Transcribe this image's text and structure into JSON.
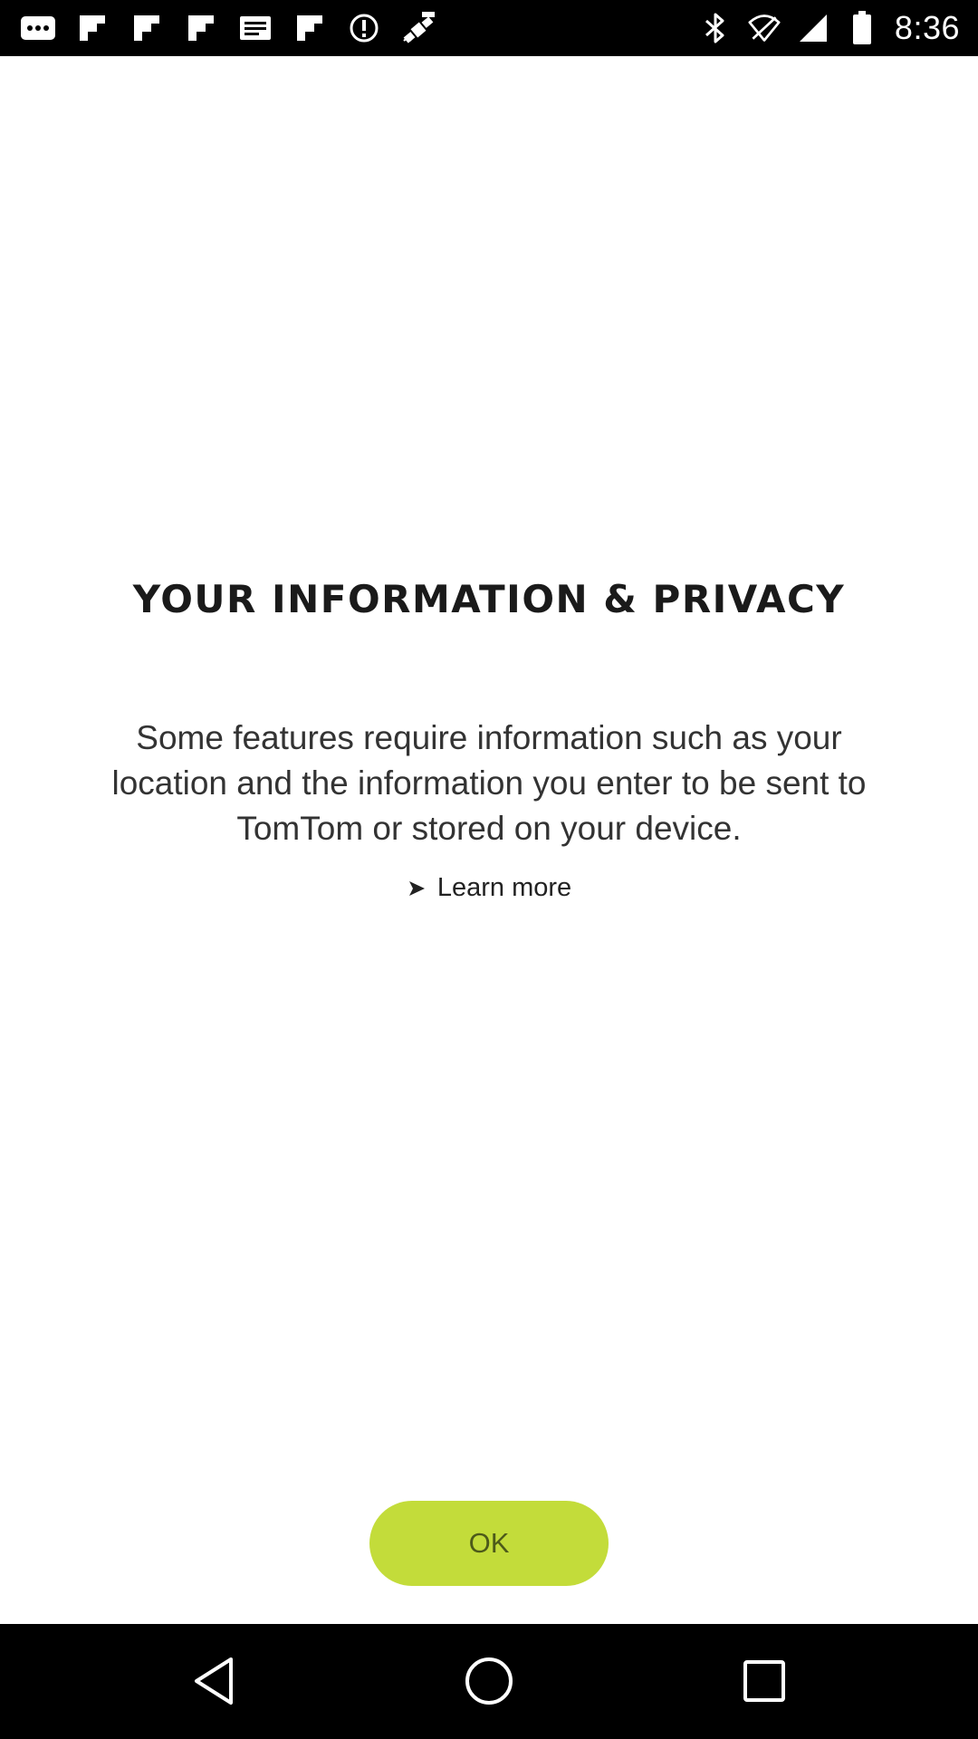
{
  "status_bar": {
    "time": "8:36",
    "notification_icons": [
      "more-dots-icon",
      "flipboard-icon",
      "flipboard-icon",
      "flipboard-icon",
      "message-icon",
      "flipboard-icon",
      "info-circle-icon",
      "fake-gps-icon"
    ],
    "system_icons": [
      "bluetooth-icon",
      "wifi-off-icon",
      "signal-icon",
      "battery-icon"
    ]
  },
  "privacy": {
    "title": "YOUR INFORMATION & PRIVACY",
    "body_lines": [
      "Some features require information such as your",
      "location and the information you enter to be sent to",
      "TomTom or stored on your device."
    ],
    "learn_more_label": "Learn more"
  },
  "ok_button": {
    "label": "OK"
  },
  "nav_bar": {
    "buttons": [
      "back-icon",
      "home-icon",
      "recents-icon"
    ]
  },
  "colors": {
    "accent_green": "#c3dc3a",
    "bar_black": "#000000",
    "background": "#ffffff"
  }
}
